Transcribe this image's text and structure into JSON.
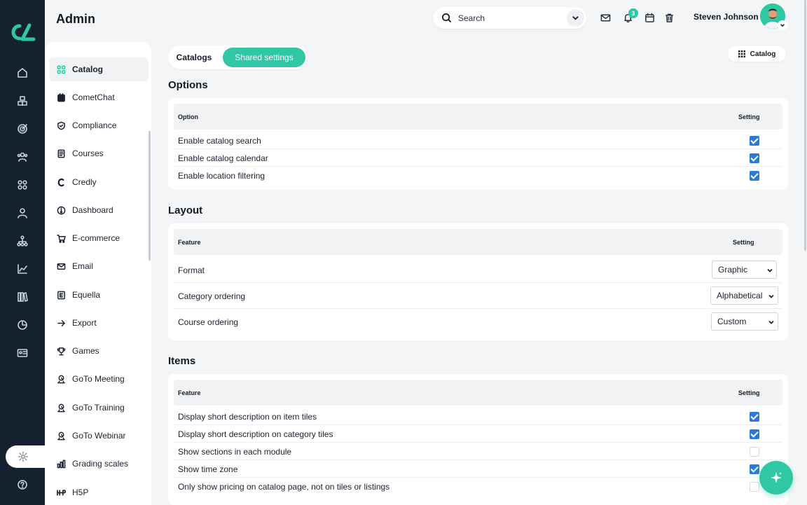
{
  "header": {
    "title": "Admin",
    "search_placeholder": "Search",
    "notification_count": "3",
    "user_name": "Steven Johnson"
  },
  "rail": {
    "icons": [
      "home-icon",
      "cubes-icon",
      "target-icon",
      "users-icon",
      "apps-icon",
      "user-icon",
      "hierarchy-icon",
      "chart-line-icon",
      "library-icon",
      "pie-chart-icon",
      "id-card-icon",
      "settings-icon",
      "help-icon"
    ],
    "active": "settings-icon"
  },
  "subnav": {
    "items": [
      {
        "label": "Catalog",
        "icon": "grid-icon",
        "active": true
      },
      {
        "label": "CometChat",
        "icon": "chat-icon"
      },
      {
        "label": "Compliance",
        "icon": "shield-icon"
      },
      {
        "label": "Courses",
        "icon": "document-icon"
      },
      {
        "label": "Credly",
        "icon": "credly-icon"
      },
      {
        "label": "Dashboard",
        "icon": "dashboard-icon"
      },
      {
        "label": "E-commerce",
        "icon": "cart-icon"
      },
      {
        "label": "Email",
        "icon": "mail-icon"
      },
      {
        "label": "Equella",
        "icon": "equella-icon"
      },
      {
        "label": "Export",
        "icon": "arrow-right-icon"
      },
      {
        "label": "Games",
        "icon": "trophy-icon"
      },
      {
        "label": "GoTo Meeting",
        "icon": "goto-icon"
      },
      {
        "label": "GoTo Training",
        "icon": "goto-icon"
      },
      {
        "label": "GoTo Webinar",
        "icon": "goto-icon"
      },
      {
        "label": "Grading scales",
        "icon": "bars-icon"
      },
      {
        "label": "H5P",
        "icon": "h5p-icon"
      }
    ]
  },
  "tabs": {
    "catalogs": "Catalogs",
    "shared_settings": "Shared settings",
    "active": "shared_settings"
  },
  "catalog_button": "Catalog",
  "options": {
    "title": "Options",
    "col_option": "Option",
    "col_setting": "Setting",
    "rows": [
      {
        "label": "Enable catalog search",
        "checked": true
      },
      {
        "label": "Enable catalog calendar",
        "checked": true
      },
      {
        "label": "Enable location filtering",
        "checked": true
      }
    ]
  },
  "layout": {
    "title": "Layout",
    "col_feature": "Feature",
    "col_setting": "Setting",
    "rows": [
      {
        "label": "Format",
        "value": "Graphic"
      },
      {
        "label": "Category ordering",
        "value": "Alphabetical"
      },
      {
        "label": "Course ordering",
        "value": "Custom"
      }
    ]
  },
  "items": {
    "title": "Items",
    "col_feature": "Feature",
    "col_setting": "Setting",
    "rows": [
      {
        "label": "Display short description on item tiles",
        "checked": true
      },
      {
        "label": "Display short description on category tiles",
        "checked": true
      },
      {
        "label": "Show sections in each module",
        "checked": false
      },
      {
        "label": "Show time zone",
        "checked": true
      },
      {
        "label": "Only show pricing on catalog page, not on tiles or listings",
        "checked": false
      }
    ]
  },
  "colors": {
    "accent": "#2fc7a4",
    "rail_bg": "#14212f",
    "checkbox": "#2a7bd5",
    "page_bg": "#f4f5f7"
  }
}
